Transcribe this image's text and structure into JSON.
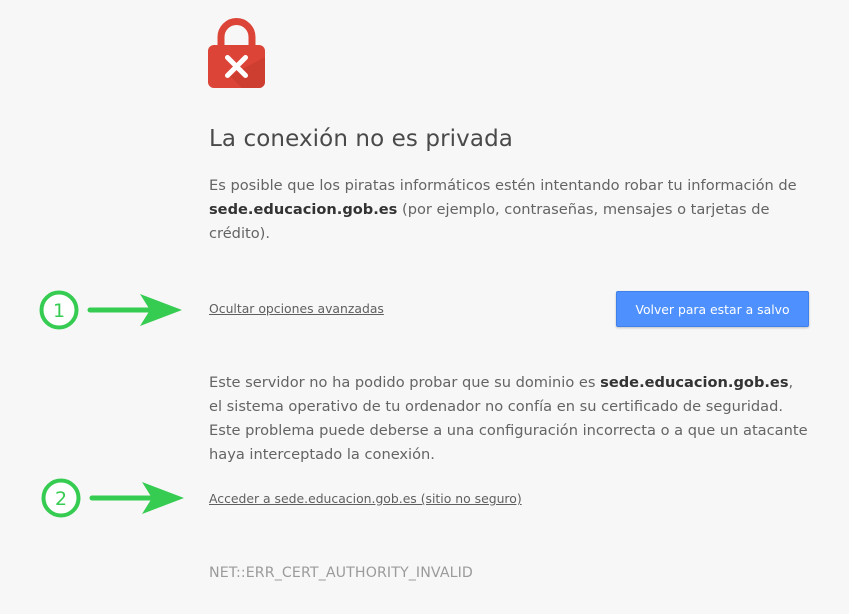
{
  "colors": {
    "background": "#f7f7f7",
    "lock_red": "#db4437",
    "button_blue": "#4d90fe",
    "annotation_green": "#36cc51"
  },
  "icons": {
    "lock": "lock-error-icon",
    "arrow": "arrow-right-icon"
  },
  "error": {
    "title": "La conexión no es privada",
    "intro_before": "Es posible que los piratas informáticos estén intentando robar tu información de ",
    "domain": "sede.educacion.gob.es",
    "intro_after": " (por ejemplo, contraseñas, mensajes o tarjetas de crédito).",
    "advanced_link": "Ocultar opciones avanzadas",
    "primary_button": "Volver para estar a salvo",
    "details_before": "Este servidor no ha podido probar que su dominio es ",
    "details_after": ", el sistema operativo de tu ordenador no confía en su certificado de seguridad. Este problema puede deberse a una configuración incorrecta o a que un atacante haya interceptado la conexión.",
    "proceed_link": "Acceder a sede.educacion.gob.es (sitio no seguro)",
    "error_code": "NET::ERR_CERT_AUTHORITY_INVALID"
  },
  "annotations": [
    {
      "number": "1"
    },
    {
      "number": "2"
    }
  ]
}
